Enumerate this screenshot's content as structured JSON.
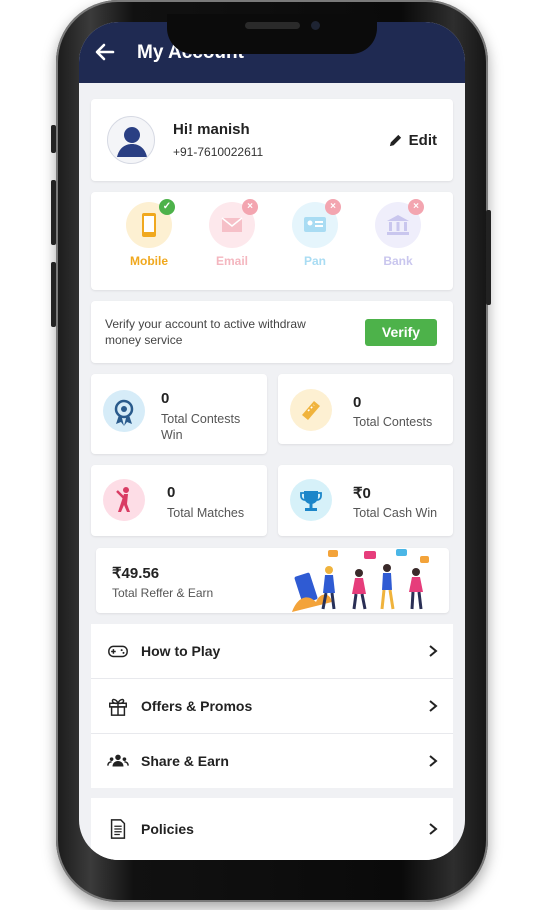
{
  "header": {
    "title": "My Account"
  },
  "profile": {
    "greeting": "Hi! manish",
    "phone": "+91-7610022611",
    "edit_label": "Edit"
  },
  "verification": {
    "items": [
      {
        "label": "Mobile",
        "status": "verified",
        "color": "#f0a81e"
      },
      {
        "label": "Email",
        "status": "unverified",
        "color": "#f4b6bf"
      },
      {
        "label": "Pan",
        "status": "unverified",
        "color": "#a9dcf3"
      },
      {
        "label": "Bank",
        "status": "unverified",
        "color": "#c9c6ee"
      }
    ],
    "message": "Verify your account to active withdraw money service",
    "button_label": "Verify"
  },
  "stats": [
    {
      "value": "0",
      "label": "Total Contests Win",
      "icon": "medal-icon"
    },
    {
      "value": "0",
      "label": "Total Contests",
      "icon": "ticket-icon"
    },
    {
      "value": "0",
      "label": "Total Matches",
      "icon": "cricket-player-icon"
    },
    {
      "value": "₹0",
      "label": "Total Cash Win",
      "icon": "trophy-icon"
    }
  ],
  "refer": {
    "amount": "₹49.56",
    "label": "Total Reffer & Earn"
  },
  "menu": {
    "items": [
      {
        "label": "How to Play",
        "icon": "gamepad-icon"
      },
      {
        "label": "Offers & Promos",
        "icon": "gift-icon"
      },
      {
        "label": "Share & Earn",
        "icon": "users-icon"
      }
    ],
    "policies_label": "Policies"
  },
  "colors": {
    "header_bg": "#1f2a52",
    "verify_green": "#4db24a",
    "screen_bg": "#f0f1f4"
  }
}
